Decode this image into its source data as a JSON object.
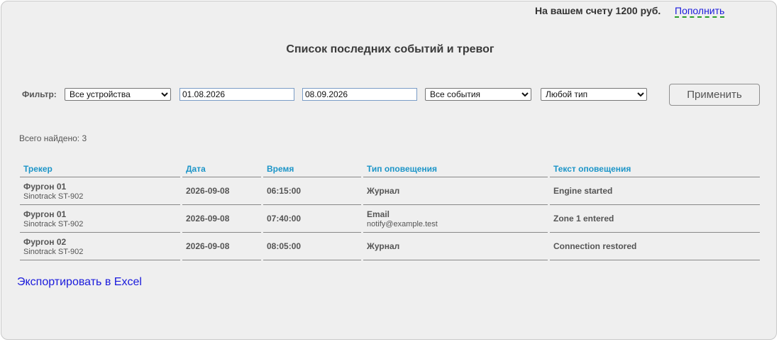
{
  "header": {
    "balance_text": "На вашем счету 1200 руб.",
    "topup_label": "Пополнить"
  },
  "page_title": "Список последних событий и тревог",
  "filter": {
    "label": "Фильтр:",
    "device_select": "Все устройства",
    "date_from": "01.08.2026",
    "date_to": "08.09.2026",
    "events_select": "Все события",
    "type_select": "Любой тип",
    "apply_label": "Применить"
  },
  "found_text": "Всего найдено: 3",
  "table": {
    "headers": [
      "Трекер",
      "Дата",
      "Время",
      "Тип оповещения",
      "Текст оповещения"
    ],
    "rows": [
      {
        "tracker": "Фургон 01",
        "model": "Sinotrack ST-902",
        "date": "2026-09-08",
        "time": "06:15:00",
        "type": "Журнал",
        "type_sub": "",
        "text": "Engine started"
      },
      {
        "tracker": "Фургон 01",
        "model": "Sinotrack ST-902",
        "date": "2026-09-08",
        "time": "07:40:00",
        "type": "Email",
        "type_sub": "notify@example.test",
        "text": "Zone 1 entered"
      },
      {
        "tracker": "Фургон 02",
        "model": "Sinotrack ST-902",
        "date": "2026-09-08",
        "time": "08:05:00",
        "type": "Журнал",
        "type_sub": "",
        "text": "Connection restored"
      }
    ]
  },
  "export_label": "Экспортировать в Excel",
  "colors": {
    "header_text": "#1c95c8",
    "link": "#1a1adc",
    "topup_underline": "#2a9d2a",
    "panel_bg": "#efefef"
  }
}
